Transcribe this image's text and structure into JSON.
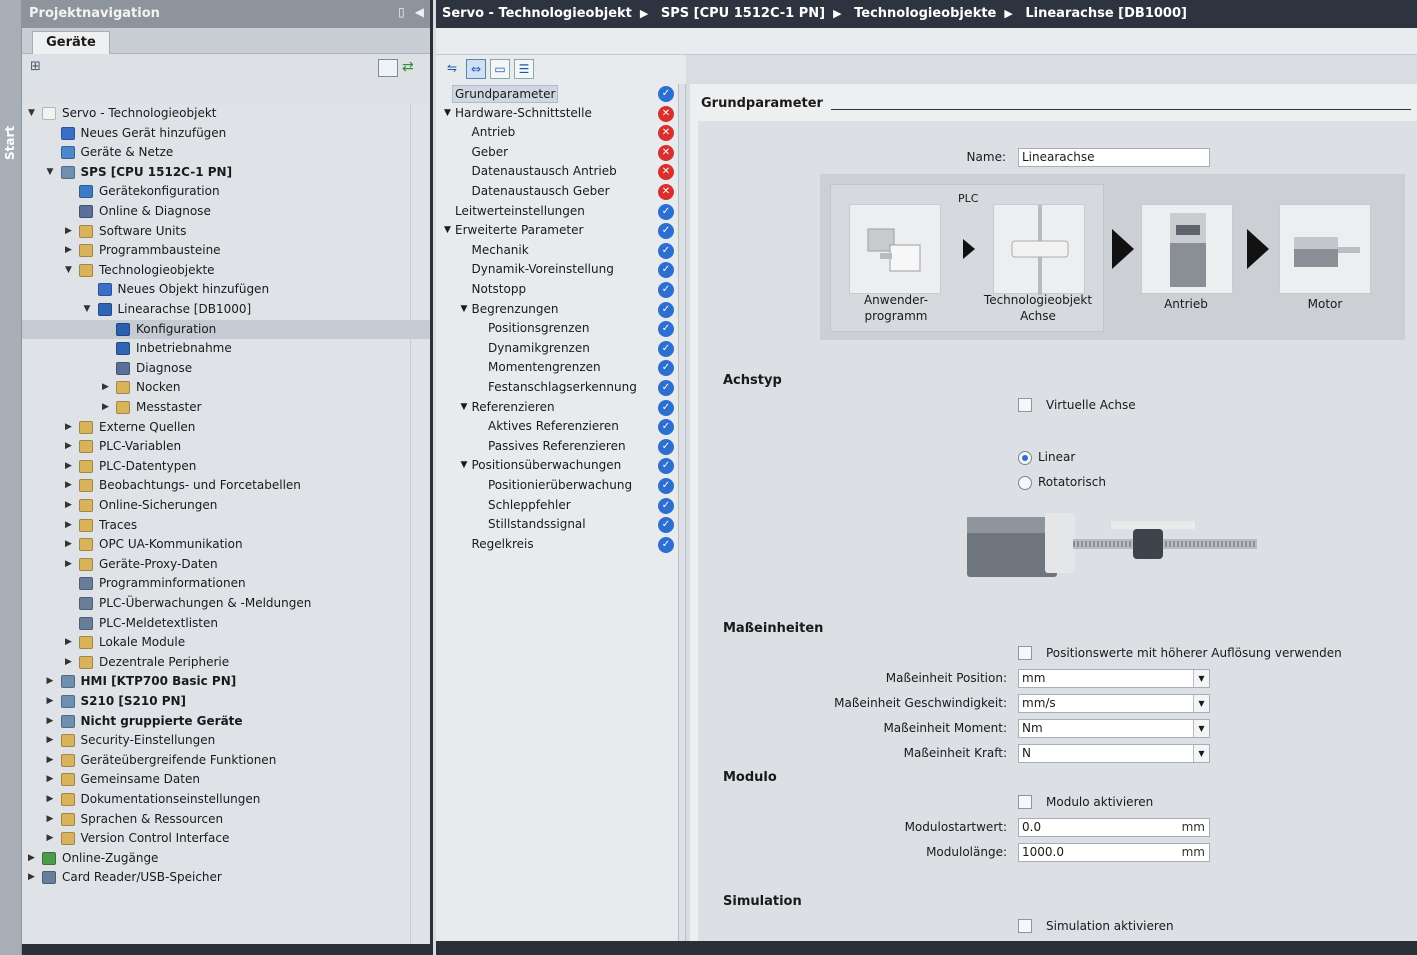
{
  "start_strip": {
    "label": "Start"
  },
  "project_nav": {
    "title": "Projektnavigation",
    "tab": "Geräte",
    "tree": [
      {
        "label": "Servo - Technologieobjekt",
        "level": 0,
        "toggle": "expanded",
        "icon": "project-icon",
        "color": "#f2f2f2"
      },
      {
        "label": "Neues Gerät hinzufügen",
        "level": 1,
        "toggle": "none",
        "icon": "add-device-icon",
        "color": "#3a6fc7"
      },
      {
        "label": "Geräte & Netze",
        "level": 1,
        "toggle": "none",
        "icon": "network-icon",
        "color": "#4b87c9"
      },
      {
        "label": "SPS [CPU 1512C-1 PN]",
        "level": 1,
        "toggle": "expanded",
        "icon": "plc-icon",
        "color": "#6f8fb0",
        "bold": true
      },
      {
        "label": "Gerätekonfiguration",
        "level": 2,
        "toggle": "none",
        "icon": "device-config-icon",
        "color": "#3f7ac4"
      },
      {
        "label": "Online & Diagnose",
        "level": 2,
        "toggle": "none",
        "icon": "diagnostics-icon",
        "color": "#5c6f9a"
      },
      {
        "label": "Software Units",
        "level": 2,
        "toggle": "collapsed",
        "icon": "folder-icon",
        "color": "#d9b35a"
      },
      {
        "label": "Programmbausteine",
        "level": 2,
        "toggle": "collapsed",
        "icon": "folder-icon",
        "color": "#d9b35a"
      },
      {
        "label": "Technologieobjekte",
        "level": 2,
        "toggle": "expanded",
        "icon": "folder-icon",
        "color": "#d9b35a"
      },
      {
        "label": "Neues Objekt hinzufügen",
        "level": 3,
        "toggle": "none",
        "icon": "add-object-icon",
        "color": "#3a6fc7"
      },
      {
        "label": "Linearachse [DB1000]",
        "level": 3,
        "toggle": "expanded",
        "icon": "axis-icon",
        "color": "#2f66b3"
      },
      {
        "label": "Konfiguration",
        "level": 4,
        "toggle": "none",
        "icon": "configuration-icon",
        "color": "#2a5fb0",
        "selected": true
      },
      {
        "label": "Inbetriebnahme",
        "level": 4,
        "toggle": "none",
        "icon": "commissioning-icon",
        "color": "#2f66b3"
      },
      {
        "label": "Diagnose",
        "level": 4,
        "toggle": "none",
        "icon": "diagnostics-icon",
        "color": "#5c6f9a"
      },
      {
        "label": "Nocken",
        "level": 4,
        "toggle": "collapsed",
        "icon": "folder-icon",
        "color": "#d9b35a"
      },
      {
        "label": "Messtaster",
        "level": 4,
        "toggle": "collapsed",
        "icon": "folder-icon",
        "color": "#d9b35a"
      },
      {
        "label": "Externe Quellen",
        "level": 2,
        "toggle": "collapsed",
        "icon": "folder-icon",
        "color": "#d9b35a"
      },
      {
        "label": "PLC-Variablen",
        "level": 2,
        "toggle": "collapsed",
        "icon": "folder-icon",
        "color": "#d9b35a"
      },
      {
        "label": "PLC-Datentypen",
        "level": 2,
        "toggle": "collapsed",
        "icon": "folder-icon",
        "color": "#d9b35a"
      },
      {
        "label": "Beobachtungs- und Forcetabellen",
        "level": 2,
        "toggle": "collapsed",
        "icon": "folder-icon",
        "color": "#d9b35a"
      },
      {
        "label": "Online-Sicherungen",
        "level": 2,
        "toggle": "collapsed",
        "icon": "folder-icon",
        "color": "#d9b35a"
      },
      {
        "label": "Traces",
        "level": 2,
        "toggle": "collapsed",
        "icon": "folder-icon",
        "color": "#d9b35a"
      },
      {
        "label": "OPC UA-Kommunikation",
        "level": 2,
        "toggle": "collapsed",
        "icon": "folder-icon",
        "color": "#d9b35a"
      },
      {
        "label": "Geräte-Proxy-Daten",
        "level": 2,
        "toggle": "collapsed",
        "icon": "folder-icon",
        "color": "#d9b35a"
      },
      {
        "label": "Programminformationen",
        "level": 2,
        "toggle": "none",
        "icon": "program-info-icon",
        "color": "#6a7d99"
      },
      {
        "label": "PLC-Überwachungen & -Meldungen",
        "level": 2,
        "toggle": "none",
        "icon": "alarm-icon",
        "color": "#6a7d99"
      },
      {
        "label": "PLC-Meldetextlisten",
        "level": 2,
        "toggle": "none",
        "icon": "text-list-icon",
        "color": "#6a7d99"
      },
      {
        "label": "Lokale Module",
        "level": 2,
        "toggle": "collapsed",
        "icon": "folder-icon",
        "color": "#d9b35a"
      },
      {
        "label": "Dezentrale Peripherie",
        "level": 2,
        "toggle": "collapsed",
        "icon": "folder-icon",
        "color": "#d9b35a"
      },
      {
        "label": "HMI [KTP700 Basic PN]",
        "level": 1,
        "toggle": "collapsed",
        "icon": "hmi-icon",
        "color": "#6f8fb0",
        "bold": true
      },
      {
        "label": "S210 [S210 PN]",
        "level": 1,
        "toggle": "collapsed",
        "icon": "drive-icon",
        "color": "#6f8fb0",
        "bold": true
      },
      {
        "label": "Nicht gruppierte Geräte",
        "level": 1,
        "toggle": "collapsed",
        "icon": "ungrouped-devices-icon",
        "color": "#6f8fb0",
        "bold": true
      },
      {
        "label": "Security-Einstellungen",
        "level": 1,
        "toggle": "collapsed",
        "icon": "security-icon",
        "color": "#d9b35a"
      },
      {
        "label": "Geräteübergreifende Funktionen",
        "level": 1,
        "toggle": "collapsed",
        "icon": "folder-icon",
        "color": "#d9b35a"
      },
      {
        "label": "Gemeinsame Daten",
        "level": 1,
        "toggle": "collapsed",
        "icon": "folder-icon",
        "color": "#d9b35a"
      },
      {
        "label": "Dokumentationseinstellungen",
        "level": 1,
        "toggle": "collapsed",
        "icon": "folder-icon",
        "color": "#d9b35a"
      },
      {
        "label": "Sprachen & Ressourcen",
        "level": 1,
        "toggle": "collapsed",
        "icon": "languages-icon",
        "color": "#d9b35a"
      },
      {
        "label": "Version Control Interface",
        "level": 1,
        "toggle": "collapsed",
        "icon": "version-control-icon",
        "color": "#d9b35a"
      },
      {
        "label": "Online-Zugänge",
        "level": 0,
        "toggle": "collapsed",
        "icon": "online-access-icon",
        "color": "#4c9a4c"
      },
      {
        "label": "Card Reader/USB-Speicher",
        "level": 0,
        "toggle": "collapsed",
        "icon": "card-reader-icon",
        "color": "#6a7d99"
      }
    ]
  },
  "breadcrumb": [
    "Servo - Technologieobjekt",
    "SPS [CPU 1512C-1 PN]",
    "Technologieobjekte",
    "Linearachse [DB1000]"
  ],
  "config_nav": {
    "items": [
      {
        "label": "Grundparameter",
        "level": 0,
        "toggle": "none",
        "status": "ok",
        "highlight": true
      },
      {
        "label": "Hardware-Schnittstelle",
        "level": 0,
        "toggle": "expanded",
        "status": "err"
      },
      {
        "label": "Antrieb",
        "level": 1,
        "toggle": "none",
        "status": "err"
      },
      {
        "label": "Geber",
        "level": 1,
        "toggle": "none",
        "status": "err"
      },
      {
        "label": "Datenaustausch Antrieb",
        "level": 1,
        "toggle": "none",
        "status": "err"
      },
      {
        "label": "Datenaustausch Geber",
        "level": 1,
        "toggle": "none",
        "status": "err"
      },
      {
        "label": "Leitwerteinstellungen",
        "level": 0,
        "toggle": "none",
        "status": "ok"
      },
      {
        "label": "Erweiterte Parameter",
        "level": 0,
        "toggle": "expanded",
        "status": "ok"
      },
      {
        "label": "Mechanik",
        "level": 1,
        "toggle": "none",
        "status": "ok"
      },
      {
        "label": "Dynamik-Voreinstellung",
        "level": 1,
        "toggle": "none",
        "status": "ok"
      },
      {
        "label": "Notstopp",
        "level": 1,
        "toggle": "none",
        "status": "ok"
      },
      {
        "label": "Begrenzungen",
        "level": 1,
        "toggle": "expanded",
        "status": "ok"
      },
      {
        "label": "Positionsgrenzen",
        "level": 2,
        "toggle": "none",
        "status": "ok"
      },
      {
        "label": "Dynamikgrenzen",
        "level": 2,
        "toggle": "none",
        "status": "ok"
      },
      {
        "label": "Momentengrenzen",
        "level": 2,
        "toggle": "none",
        "status": "ok"
      },
      {
        "label": "Festanschlagserkennung",
        "level": 2,
        "toggle": "none",
        "status": "ok"
      },
      {
        "label": "Referenzieren",
        "level": 1,
        "toggle": "expanded",
        "status": "ok"
      },
      {
        "label": "Aktives Referenzieren",
        "level": 2,
        "toggle": "none",
        "status": "ok"
      },
      {
        "label": "Passives Referenzieren",
        "level": 2,
        "toggle": "none",
        "status": "ok"
      },
      {
        "label": "Positionsüberwachungen",
        "level": 1,
        "toggle": "expanded",
        "status": "ok"
      },
      {
        "label": "Positionierüberwachung",
        "level": 2,
        "toggle": "none",
        "status": "ok"
      },
      {
        "label": "Schleppfehler",
        "level": 2,
        "toggle": "none",
        "status": "ok"
      },
      {
        "label": "Stillstandssignal",
        "level": 2,
        "toggle": "none",
        "status": "ok"
      },
      {
        "label": "Regelkreis",
        "level": 1,
        "toggle": "none",
        "status": "ok"
      }
    ]
  },
  "content": {
    "section_title": "Grundparameter",
    "name_label": "Name:",
    "name_value": "Linearachse",
    "diagram": {
      "plc_label": "PLC",
      "captions": [
        "Anwender-\nprogramm",
        "Technologieobjekt\nAchse",
        "Antrieb",
        "Motor"
      ]
    },
    "achstyp": {
      "heading": "Achstyp",
      "virtual_axis": "Virtuelle Achse",
      "virtual_axis_checked": false,
      "linear": "Linear",
      "rotatorisch": "Rotatorisch",
      "selected": "Linear"
    },
    "masseinheiten": {
      "heading": "Maßeinheiten",
      "high_res_label": "Positionswerte mit höherer Auflösung verwenden",
      "high_res_checked": false,
      "position_label": "Maßeinheit Position:",
      "position_value": "mm",
      "speed_label": "Maßeinheit Geschwindigkeit:",
      "speed_value": "mm/s",
      "torque_label": "Maßeinheit Moment:",
      "torque_value": "Nm",
      "force_label": "Maßeinheit Kraft:",
      "force_value": "N"
    },
    "modulo": {
      "heading": "Modulo",
      "enable_label": "Modulo aktivieren",
      "enable_checked": false,
      "start_label": "Modulostartwert:",
      "start_value": "0.0",
      "start_unit": "mm",
      "length_label": "Modulolänge:",
      "length_value": "1000.0",
      "length_unit": "mm"
    },
    "simulation": {
      "heading": "Simulation",
      "enable_label": "Simulation aktivieren",
      "enable_checked": false
    }
  },
  "colors": {
    "ok": "#2c6fd1",
    "err": "#d7302f",
    "breadcrumb_bg": "#2d3440",
    "panel_title_bg": "#8d949c"
  }
}
